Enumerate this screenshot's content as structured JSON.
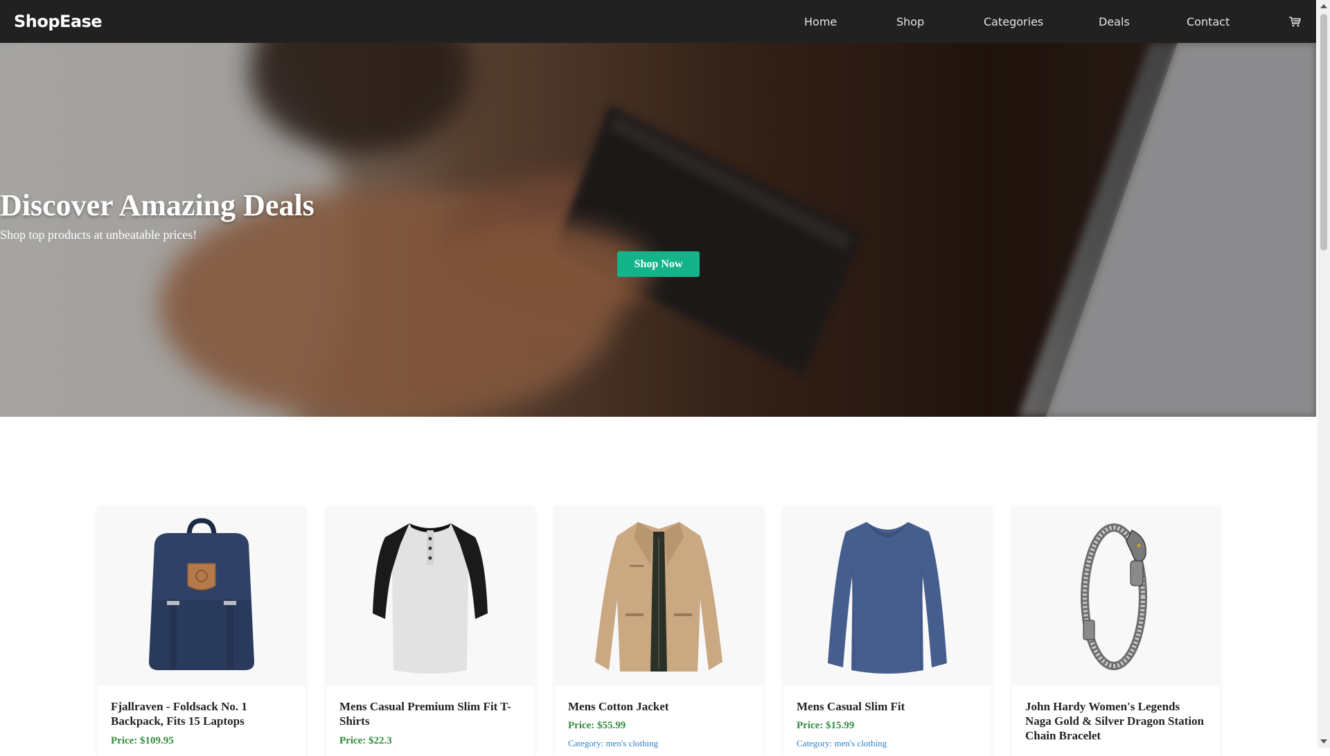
{
  "brand": "ShopEase",
  "nav": {
    "links": [
      "Home",
      "Shop",
      "Categories",
      "Deals",
      "Contact"
    ],
    "cart_icon": "cart-icon"
  },
  "hero": {
    "title": "Discover Amazing Deals",
    "subtitle": "Shop top products at unbeatable prices!",
    "button": "Shop Now"
  },
  "products": [
    {
      "title": "Fjallraven - Foldsack No. 1 Backpack, Fits 15 Laptops",
      "price": "Price: $109.95",
      "category": "",
      "image_icon": "backpack-image"
    },
    {
      "title": "Mens Casual Premium Slim Fit T-Shirts",
      "price": "Price: $22.3",
      "category": "",
      "image_icon": "tshirt-image"
    },
    {
      "title": "Mens Cotton Jacket",
      "price": "Price: $55.99",
      "category": "Category: men's clothing",
      "image_icon": "jacket-image"
    },
    {
      "title": "Mens Casual Slim Fit",
      "price": "Price: $15.99",
      "category": "Category: men's clothing",
      "image_icon": "sweater-image"
    },
    {
      "title": "John Hardy Women's Legends Naga Gold & Silver Dragon Station Chain Bracelet",
      "price": "",
      "category": "",
      "image_icon": "bracelet-image"
    }
  ],
  "colors": {
    "navbar": "#212121",
    "accent": "#14b38a",
    "price": "#2e8b3a",
    "category": "#2d7fc4"
  }
}
